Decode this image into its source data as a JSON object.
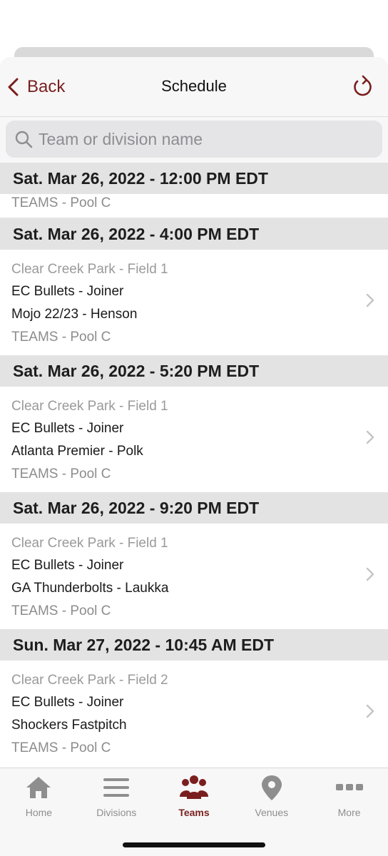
{
  "nav": {
    "back_label": "Back",
    "title": "Schedule"
  },
  "search": {
    "placeholder": "Team or division name"
  },
  "schedule": {
    "first_header": "Sat. Mar 26, 2022 - 12:00 PM EDT",
    "first_pool": "TEAMS - Pool C",
    "games": [
      {
        "date": "Sat. Mar 26, 2022 - 4:00 PM EDT",
        "venue": "Clear Creek Park - Field 1",
        "team1": "EC Bullets - Joiner",
        "team2": "Mojo 22/23 - Henson",
        "pool": "TEAMS - Pool C"
      },
      {
        "date": "Sat. Mar 26, 2022 - 5:20 PM EDT",
        "venue": "Clear Creek Park - Field 1",
        "team1": "EC Bullets - Joiner",
        "team2": "Atlanta Premier - Polk",
        "pool": "TEAMS - Pool C"
      },
      {
        "date": "Sat. Mar 26, 2022 - 9:20 PM EDT",
        "venue": "Clear Creek Park - Field 1",
        "team1": "EC Bullets - Joiner",
        "team2": "GA Thunderbolts - Laukka",
        "pool": "TEAMS - Pool C"
      },
      {
        "date": "Sun. Mar 27, 2022 - 10:45 AM EDT",
        "venue": "Clear Creek Park - Field 2",
        "team1": "EC Bullets - Joiner",
        "team2": "Shockers Fastpitch",
        "pool": "TEAMS - Pool C"
      }
    ]
  },
  "tabbar": {
    "items": [
      {
        "label": "Home",
        "icon": "home-icon"
      },
      {
        "label": "Divisions",
        "icon": "list-icon"
      },
      {
        "label": "Teams",
        "icon": "people-icon",
        "active": true
      },
      {
        "label": "Venues",
        "icon": "location-pin-icon"
      },
      {
        "label": "More",
        "icon": "more-dots-icon"
      }
    ]
  },
  "colors": {
    "accent": "#7a1f1f",
    "header_bg": "#e3e3e3",
    "inactive_tab": "#8e8e8e"
  }
}
